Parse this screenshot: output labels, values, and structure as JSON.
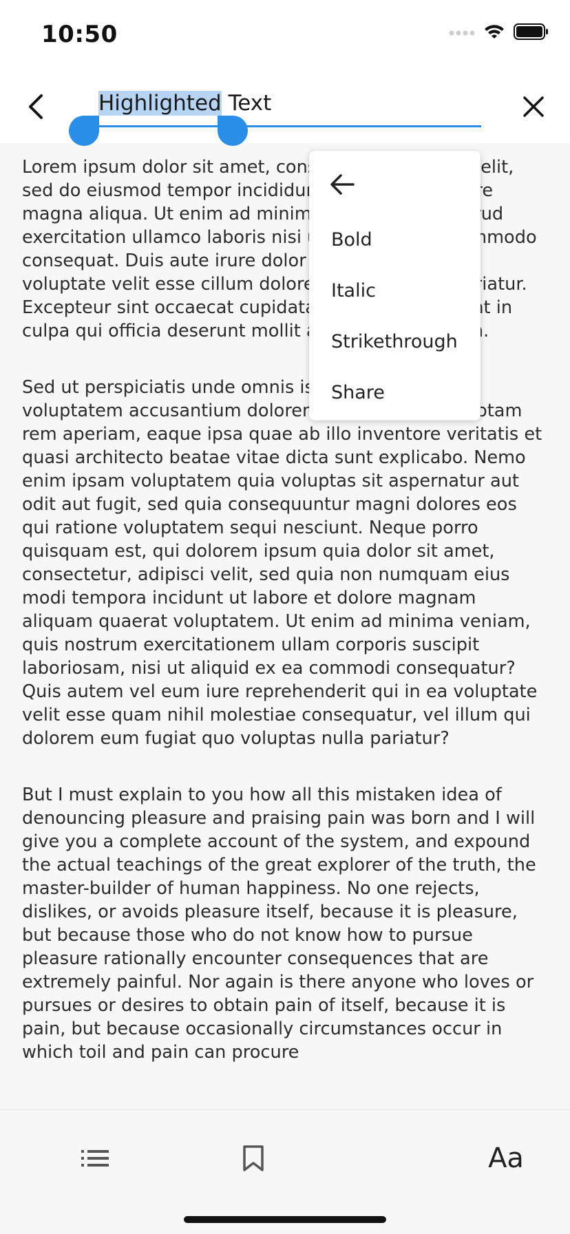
{
  "status_bar": {
    "time": "10:50",
    "icons": [
      "signal-dots-icon",
      "wifi-icon",
      "battery-icon"
    ]
  },
  "app_bar": {
    "back_icon": "chevron-left-icon",
    "search": {
      "selected_text": "Highlighted",
      "rest_text": " Text"
    },
    "close_icon": "close-icon",
    "accent_color": "#2a8de6",
    "selection_color": "#b7d4f3"
  },
  "context_menu": {
    "back_icon": "arrow-left-icon",
    "items": [
      "Bold",
      "Italic",
      "Strikethrough",
      "Share"
    ]
  },
  "content": {
    "paragraphs": [
      "Lorem ipsum dolor sit amet, consectetur adipiscing elit, sed do eiusmod tempor incididunt ut labore et dolore magna aliqua. Ut enim ad minim veniam, quis nostrud exercitation ullamco laboris nisi ut aliquip ex ea commodo consequat. Duis aute irure dolor in reprehenderit in voluptate velit esse cillum dolore eu fugiat nulla pariatur. Excepteur sint occaecat cupidatat non proident, sunt in culpa qui officia deserunt mollit anim id est laborum.",
      "Sed ut perspiciatis unde omnis iste natus error sit voluptatem accusantium doloremque laudantium, totam rem aperiam, eaque ipsa quae ab illo inventore veritatis et quasi architecto beatae vitae dicta sunt explicabo. Nemo enim ipsam voluptatem quia voluptas sit aspernatur aut odit aut fugit, sed quia consequuntur magni dolores eos qui ratione voluptatem sequi nesciunt. Neque porro quisquam est, qui dolorem ipsum quia dolor sit amet, consectetur, adipisci velit, sed quia non numquam eius modi tempora incidunt ut labore et dolore magnam aliquam quaerat voluptatem. Ut enim ad minima veniam, quis nostrum exercitationem ullam corporis suscipit laboriosam, nisi ut aliquid ex ea commodi consequatur? Quis autem vel eum iure reprehenderit qui in ea voluptate velit esse quam nihil molestiae consequatur, vel illum qui dolorem eum fugiat quo voluptas nulla pariatur?",
      "But I must explain to you how all this mistaken idea of denouncing pleasure and praising pain was born and I will give you a complete account of the system, and expound the actual teachings of the great explorer of the truth, the master-builder of human happiness. No one rejects, dislikes, or avoids pleasure itself, because it is pleasure, but because those who do not know how to pursue pleasure rationally encounter consequences that are extremely painful. Nor again is there anyone who loves or pursues or desires to obtain pain of itself, because it is pain, but because occasionally circumstances occur in which toil and pain can procure"
    ]
  },
  "bottom_nav": {
    "items": [
      "list-icon",
      "bookmark-icon",
      "moon-icon",
      "font-size-icon"
    ],
    "font_label": "Aa"
  }
}
